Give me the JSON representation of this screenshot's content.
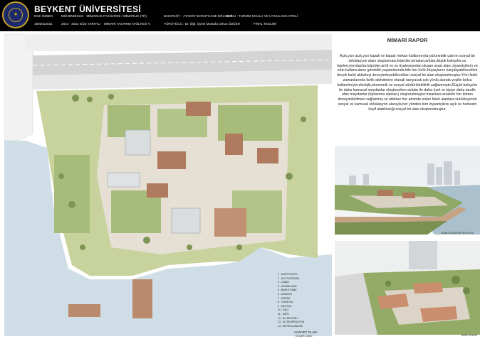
{
  "header": {
    "university": "BEYKENT ÜNİVERSİTESİ",
    "student_name": "ECE ÖZBEK",
    "student_no": "1803012031",
    "faculty": "MÜHENDİSLİK - MİMARLIK FAKÜLTESİ / MİMARLIK (TR)",
    "term": "2021 - 2022 GÜZ YARIYILI",
    "studio": "MİMARİ TASARIM ATÖLYESİ V",
    "site": "BAKIRKÖY - ATAKÖY BARUTHANE BÖLGESİ",
    "tutor": "YÜRÜTÜCÜ : Dr. Öğr. Üyesi Mustafa Orkun ÖZÜER",
    "topic": "KONU : TURİZM OKULU VE UYGULAMA OTELİ",
    "submission": "FİNAL TESLİMİ"
  },
  "report": {
    "title": "MİMARİ RAPOR",
    "body": "Açık,yarı açık,yarı kapalı ve kapalı mekan kullanımıyla;yürünebilir çatının sosyal bir sirkülasyon alanı oluşturması,köprüler,teraslar,avlular,düşük bahçeler,su ögeleri,meydanlar,köprüler,amfi ve su tiyatrosundan oluşan arazi alanı ziyaretçilerin ve rutin kullanıcıların gündelik yaşamlarında bile her türlü ihtiyaçlarını karşılayabilecekleri birçok farklı aktiviteyi deneyimleyebilecekleri sosyal bir alan oluşturulmuştur.Yılın farklı zamanlarında farklı aktivitelere olanak tanıyacak çok yönlü alanda yeşilin bolca kullanılmıyla ekolojik,ekonomik ve sosyal sürdürülebilirlik sağlanmıştır.Düşük bahçeler ile daha kamusal meydanlar oluştururken avlular ile daha özel ve kişiye daha tandık ufak meydanlar (toplanma alanları) oluşturulmuştur.İnsanlara arazinin her kottan deneyimletilmesi sağlanmış ve attıkları her adımda onları farklı alanlara sürükleyecek sosyal ve kamusal sirkülasyon alanıyla,her yönden tüm ziyaretçilere açık ve herkesin keyif alabileceği sosyal bir alan oluşturulmuştur."
  },
  "renders": {
    "caption1": "BARUTHANE'DE SU KIYISI",
    "caption2": "BARUTHANE"
  },
  "legend": [
    "1 - ANFİTİYATRO",
    "2 - SU TİYATROSU",
    "3 - LİMAN",
    "4 - KONAKLAMA",
    "5 - BARUTHANE",
    "6 - ATAÖLYE",
    "7 - EĞİTİM",
    "8 - YÖNETİM",
    "9 - MUTFAK",
    "10 - SALI",
    "11 - KAFE",
    "12 - SU DEPOSU",
    "13 - SU REKREASYON",
    "14 - SEYİR ALANLARI"
  ],
  "plan": {
    "title": "VAZİYET PLANI",
    "scale": "ÖLÇEK 1/500"
  },
  "colors": {
    "header_bg": "#000000",
    "water": "#cfdde6",
    "grass": "#a7bb7a",
    "roof": "#b07a5e",
    "paving": "#e3ddd3",
    "road": "#d2d2d2"
  }
}
